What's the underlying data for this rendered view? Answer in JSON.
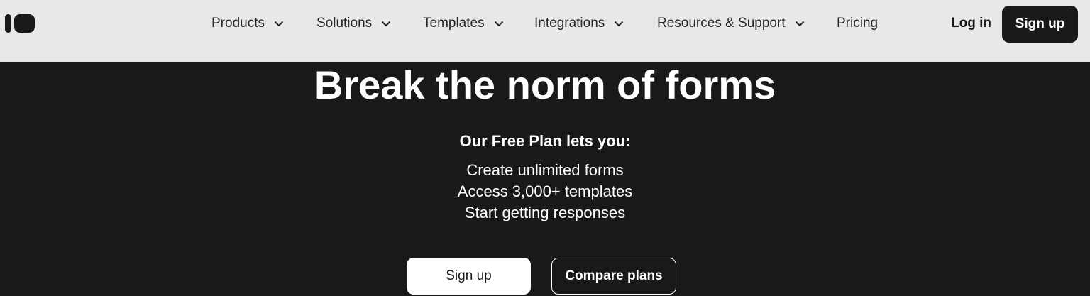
{
  "logo": {
    "icon": "typeform-logo-icon"
  },
  "nav": {
    "items": [
      {
        "label": "Products",
        "icon": "chevron-down-icon"
      },
      {
        "label": "Solutions",
        "icon": "chevron-down-icon"
      },
      {
        "label": "Templates",
        "icon": "chevron-down-icon"
      },
      {
        "label": "Integrations",
        "icon": "chevron-down-icon"
      },
      {
        "label": "Resources & Support",
        "icon": "chevron-down-icon"
      },
      {
        "label": "Pricing"
      }
    ],
    "login_label": "Log in",
    "signup_label": "Sign up"
  },
  "hero": {
    "title": "Break the norm of forms",
    "plan_heading": "Our Free Plan lets you:",
    "features": [
      "Create unlimited forms",
      "Access 3,000+ templates",
      "Start getting responses"
    ],
    "primary_cta": "Sign up",
    "secondary_cta": "Compare plans"
  },
  "colors": {
    "nav_background": "#e8e8e8",
    "hero_background": "#191919",
    "text_dark": "#262627",
    "text_light": "#ffffff"
  }
}
